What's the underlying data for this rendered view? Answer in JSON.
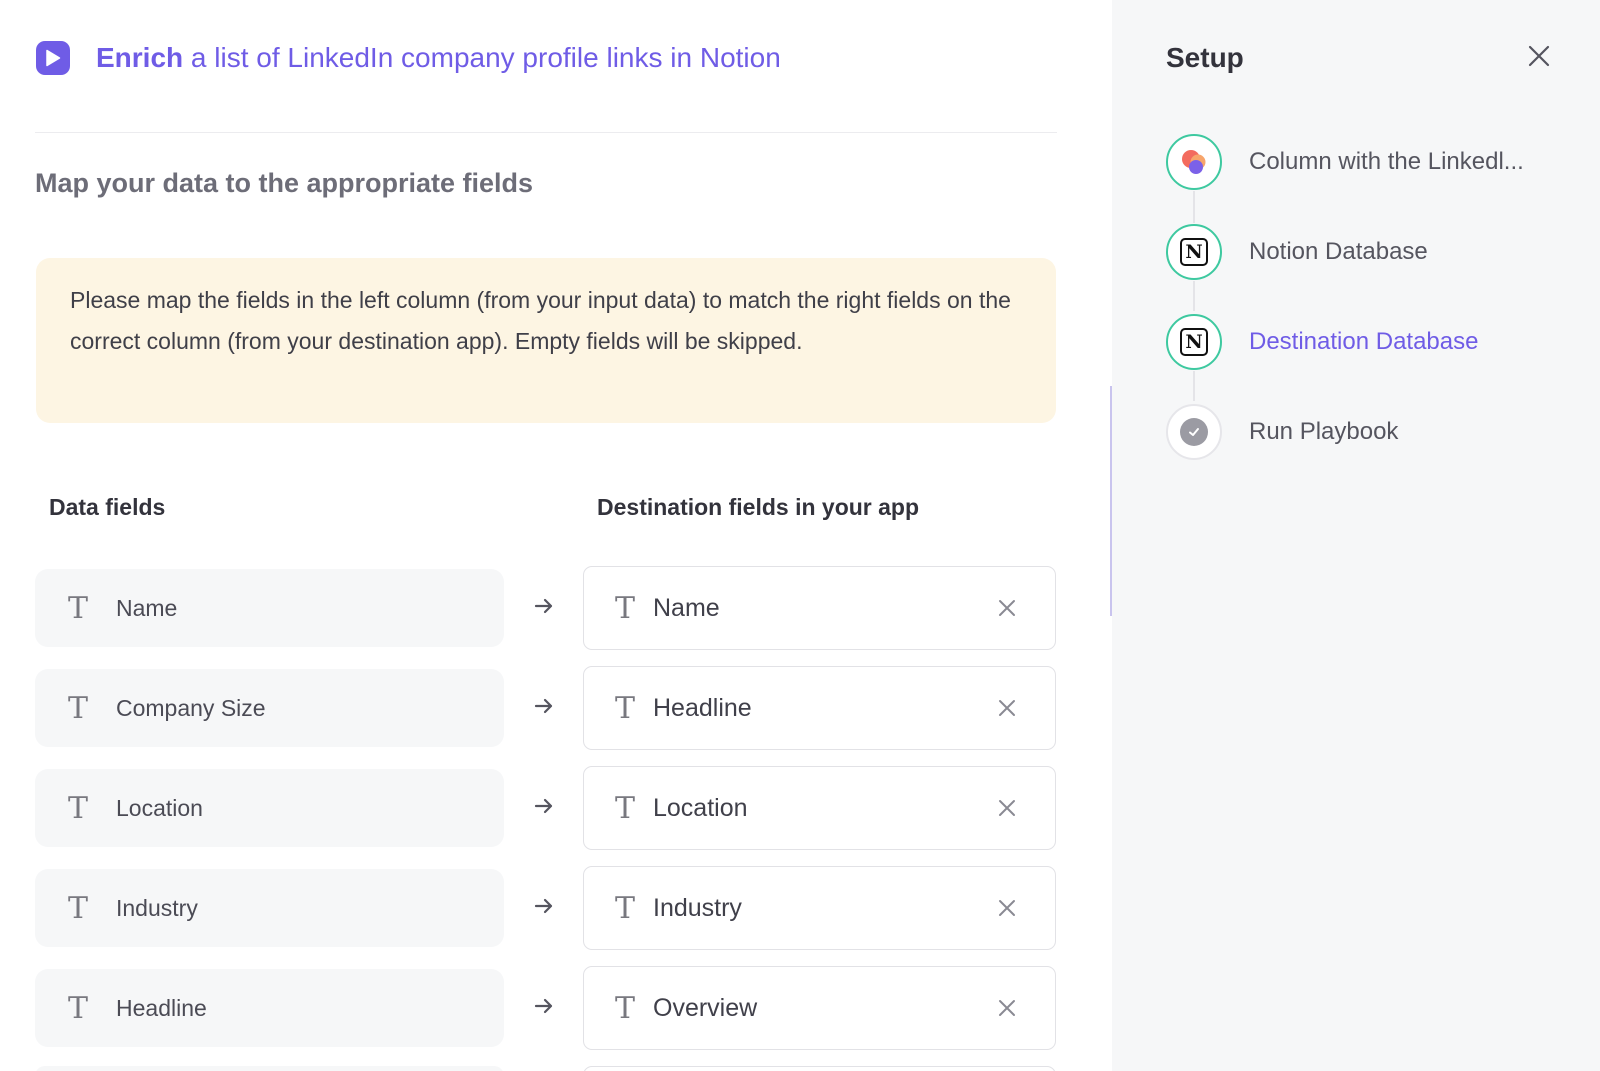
{
  "header": {
    "title_bold": "Enrich",
    "title_rest": " a list of LinkedIn company profile links in Notion",
    "icon": "play-icon",
    "accent": "#6f5ce6"
  },
  "mapping": {
    "section_title": "Map your data to the appropriate fields",
    "notice": "Please map the fields in the left column (from your input data) to match the right fields on the correct column (from your destination app). Empty fields will be skipped.",
    "left_header": "Data fields",
    "right_header": "Destination fields in your app",
    "type_glyph": "T",
    "rows": [
      {
        "source": "Name",
        "destination": "Name"
      },
      {
        "source": "Company Size",
        "destination": "Headline"
      },
      {
        "source": "Location",
        "destination": "Location"
      },
      {
        "source": "Industry",
        "destination": "Industry"
      },
      {
        "source": "Headline",
        "destination": "Overview"
      }
    ]
  },
  "setup": {
    "title": "Setup",
    "steps": [
      {
        "label": "Column with the Linkedl...",
        "icon": "app-logo-icon",
        "status": "done"
      },
      {
        "label": "Notion Database",
        "icon": "notion-icon",
        "status": "done"
      },
      {
        "label": "Destination Database",
        "icon": "notion-icon",
        "status": "active"
      },
      {
        "label": "Run Playbook",
        "icon": "check-icon",
        "status": "pending"
      }
    ],
    "notion_glyph": "N",
    "step_done_color": "#3ec9a0"
  }
}
